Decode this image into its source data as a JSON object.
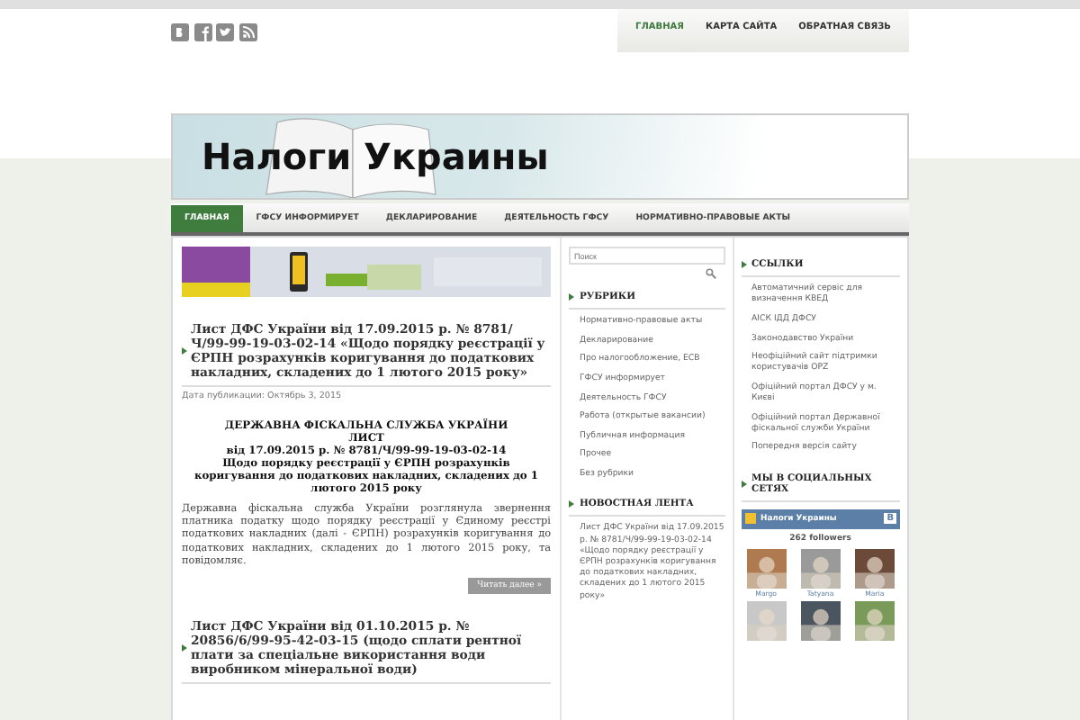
{
  "social_icons": [
    {
      "kind": "vk"
    },
    {
      "kind": "facebook"
    },
    {
      "kind": "twitter"
    },
    {
      "kind": "rss"
    }
  ],
  "top_nav": [
    {
      "label": "ГЛАВНАЯ",
      "selected": true
    },
    {
      "label": "КАРТА САЙТА",
      "selected": false
    },
    {
      "label": "ОБРАТНАЯ СВЯЗЬ",
      "selected": false
    }
  ],
  "banner": {
    "title": "Налоги Украины"
  },
  "main_menu": [
    {
      "label": "ГЛАВНАЯ",
      "selected": true
    },
    {
      "label": "ГФСУ ИНФОРМИРУЕТ",
      "selected": false
    },
    {
      "label": "ДЕКЛАРИРОВАНИЕ",
      "selected": false
    },
    {
      "label": "ДЕЯТЕЛЬНОСТЬ ГФСУ",
      "selected": false
    },
    {
      "label": "НОРМАТИВНО-ПРАВОВЫЕ АКТЫ",
      "selected": false
    }
  ],
  "ad": {
    "kind": "picture"
  },
  "posts": [
    {
      "title": "Лист ДФС України від 17.09.2015 р. № 8781/Ч/99-99-19-03-02-14 «Щодо порядку реєстрації у ЄРПН розрахунків коригування до податкових накладних, складених до 1 лютого 2015 року»",
      "date": "Дата публикации: Октябрь 3, 2015",
      "heading": [
        "ДЕРЖАВНА ФІСКАЛЬНА СЛУЖБА УКРАЇНИ",
        "ЛИСТ",
        "від 17.09.2015 р. № 8781/Ч/99-99-19-03-02-14",
        "Щодо порядку реєстрації у ЄРПН розрахунків коригування до податкових накладних, складених до 1 лютого 2015 року"
      ],
      "text": "Державна фіскальна служба України розглянула звернення платника податку щодо порядку реєстрації у Єдиному реєстрі податкових накладних (далі - ЄРПН) розрахунків коригування до податкових накладних, складених до 1 лютого 2015 року, та повідомляє.",
      "more": "Читать далее »"
    },
    {
      "title": "Лист ДФС України від 01.10.2015 р. № 20856/6/99-95-42-03-15 (щодо сплати рентної плати за спеціальне використання води виробником мінеральної води)"
    }
  ],
  "search": {
    "placeholder": "Поиск"
  },
  "rubrics": {
    "title": "РУБРИКИ",
    "items": [
      "Нормативно-правовые акты",
      "Декларирование",
      "Про налогообложение, ЕСВ",
      "ГФСУ информирует",
      "Деятельность ГФСУ",
      "Работа (открытые вакансии)",
      "Публичная информация",
      "Прочее",
      "Без рубрики"
    ]
  },
  "news": {
    "title": "НОВОСТНАЯ ЛЕНТА",
    "items": [
      "Лист ДФС України від 17.09.2015 р. № 8781/Ч/99-99-19-03-02-14 «Щодо порядку реєстрації у ЄРПН розрахунків коригування до податкових накладних, складених до 1 лютого 2015 року»"
    ]
  },
  "links": {
    "title": "ССЫЛКИ",
    "items": [
      "Автоматичний сервіс для визначення КВЕД",
      "АІСК ІДД ДФСУ",
      "Законодавство України",
      "Неофіційний сайт підтримки користувачів OPZ",
      "Офіційний портал ДФСУ у м. Києві",
      "Офіційний портал Державної фіскальної служби України",
      "Попередня версія сайту"
    ]
  },
  "social": {
    "title": "МЫ В СОЦИАЛЬНЫХ СЕТЯХ",
    "group": "Налоги Украины",
    "badge": "В",
    "followers": "262 followers",
    "members": [
      {
        "kind": "picture",
        "name": "Margo"
      },
      {
        "kind": "picture",
        "name": "Tatyana"
      },
      {
        "kind": "picture",
        "name": "Maria"
      },
      {
        "kind": "picture"
      },
      {
        "kind": "picture"
      },
      {
        "kind": "picture"
      }
    ]
  }
}
